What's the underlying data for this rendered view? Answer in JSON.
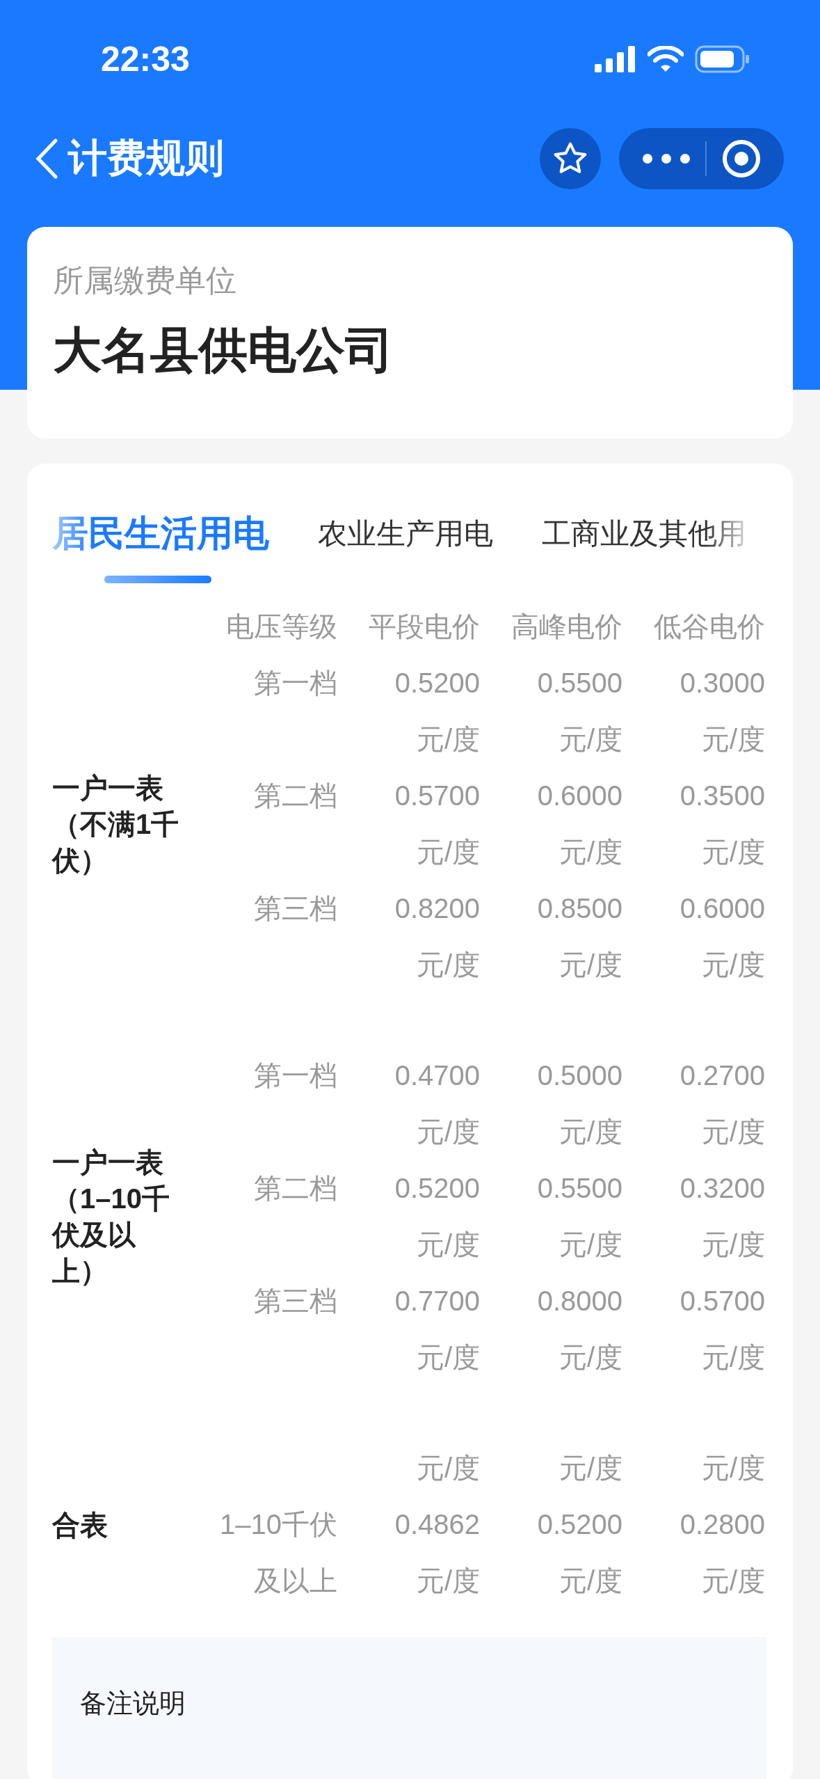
{
  "status_bar": {
    "time": "22:33"
  },
  "nav": {
    "title": "计费规则"
  },
  "unit": {
    "label": "所属缴费单位",
    "name": "大名县供电公司"
  },
  "tabs": [
    {
      "label": "居民生活用电",
      "selected": true
    },
    {
      "label": "农业生产用电",
      "selected": false
    },
    {
      "label": "工商业及其他用",
      "selected": false
    }
  ],
  "table": {
    "columns": [
      "电压等级",
      "平段电价",
      "高峰电价",
      "低谷电价"
    ],
    "groups": [
      {
        "category": "一户一表（不满1千伏）",
        "rows": [
          {
            "level": "第一档",
            "prices": [
              {
                "value": "0.5200",
                "unit": "元/度"
              },
              {
                "value": "0.5500",
                "unit": "元/度"
              },
              {
                "value": "0.3000",
                "unit": "元/度"
              }
            ]
          },
          {
            "level": "第二档",
            "prices": [
              {
                "value": "0.5700",
                "unit": "元/度"
              },
              {
                "value": "0.6000",
                "unit": "元/度"
              },
              {
                "value": "0.3500",
                "unit": "元/度"
              }
            ]
          },
          {
            "level": "第三档",
            "prices": [
              {
                "value": "0.8200",
                "unit": "元/度"
              },
              {
                "value": "0.8500",
                "unit": "元/度"
              },
              {
                "value": "0.6000",
                "unit": "元/度"
              }
            ]
          }
        ]
      },
      {
        "category": "一户一表（1–10千伏及以上）",
        "rows": [
          {
            "level": "第一档",
            "prices": [
              {
                "value": "0.4700",
                "unit": "元/度"
              },
              {
                "value": "0.5000",
                "unit": "元/度"
              },
              {
                "value": "0.2700",
                "unit": "元/度"
              }
            ]
          },
          {
            "level": "第二档",
            "prices": [
              {
                "value": "0.5200",
                "unit": "元/度"
              },
              {
                "value": "0.5500",
                "unit": "元/度"
              },
              {
                "value": "0.3200",
                "unit": "元/度"
              }
            ]
          },
          {
            "level": "第三档",
            "prices": [
              {
                "value": "0.7700",
                "unit": "元/度"
              },
              {
                "value": "0.8000",
                "unit": "元/度"
              },
              {
                "value": "0.5700",
                "unit": "元/度"
              }
            ]
          }
        ]
      },
      {
        "category": "合表",
        "rows": [
          {
            "prices": [
              {
                "unit": "元/度"
              },
              {
                "unit": "元/度"
              },
              {
                "unit": "元/度"
              }
            ]
          },
          {
            "level": "1–10千伏及以上",
            "prices": [
              {
                "value": "0.4862",
                "unit": "元/度"
              },
              {
                "value": "0.5200",
                "unit": "元/度"
              },
              {
                "value": "0.2800",
                "unit": "元/度"
              }
            ]
          }
        ]
      }
    ]
  },
  "remarks": {
    "title": "备注说明"
  }
}
